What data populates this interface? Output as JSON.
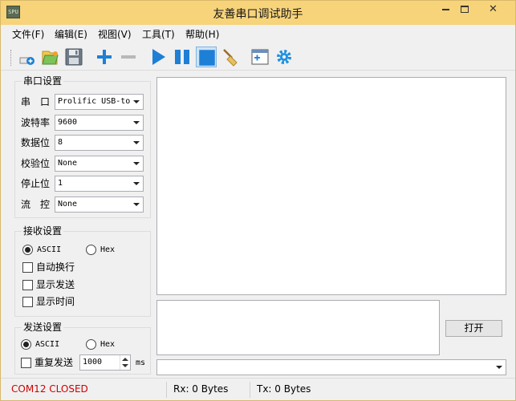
{
  "window": {
    "title": "友善串口调试助手",
    "icon_text": "SPU"
  },
  "titlebar_buttons": {
    "close": "✕"
  },
  "menu": [
    {
      "label": "文件(F)"
    },
    {
      "label": "编辑(E)"
    },
    {
      "label": "视图(V)"
    },
    {
      "label": "工具(T)"
    },
    {
      "label": "帮助(H)"
    }
  ],
  "toolbar": {
    "icons": [
      "new-icon",
      "open-icon",
      "save-icon",
      "add-icon",
      "remove-icon",
      "play-icon",
      "pause-icon",
      "stop-icon",
      "clear-broom-icon",
      "add-window-icon",
      "settings-gear-icon"
    ],
    "accent_color": "#1e7fd6"
  },
  "serial_settings": {
    "title": "串口设置",
    "port_label": "串　口",
    "port_value": "Prolific USB-to",
    "baud_label": "波特率",
    "baud_value": "9600",
    "databits_label": "数据位",
    "databits_value": "8",
    "parity_label": "校验位",
    "parity_value": "None",
    "stopbits_label": "停止位",
    "stopbits_value": "1",
    "flow_label": "流　控",
    "flow_value": "None"
  },
  "receive_settings": {
    "title": "接收设置",
    "ascii_label": "ASCII",
    "hex_label": "Hex",
    "selected": "ASCII",
    "auto_wrap_label": "自动换行",
    "show_send_label": "显示发送",
    "show_time_label": "显示时间"
  },
  "send_settings": {
    "title": "发送设置",
    "ascii_label": "ASCII",
    "hex_label": "Hex",
    "selected": "ASCII",
    "repeat_label": "重复发送",
    "interval_value": "1000",
    "interval_unit": "ms"
  },
  "open_button": {
    "label": "打开"
  },
  "status": {
    "port_status": "COM12 CLOSED",
    "port_status_color": "#d00000",
    "rx": "Rx: 0 Bytes",
    "tx": "Tx: 0 Bytes"
  }
}
